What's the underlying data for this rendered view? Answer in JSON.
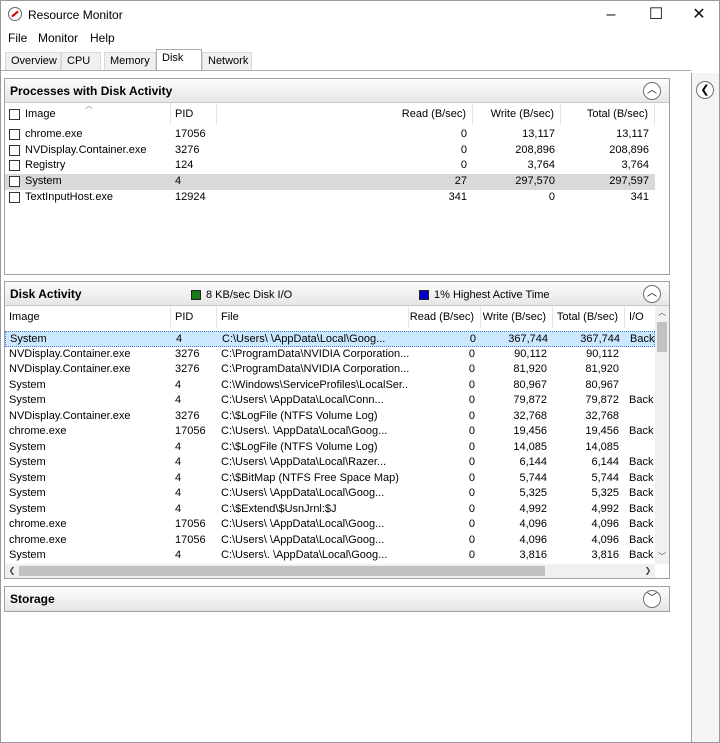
{
  "window": {
    "title": "Resource Monitor",
    "minimize": "–",
    "maximize": "☐",
    "close": "✕"
  },
  "menu": [
    "File",
    "Monitor",
    "Help"
  ],
  "tabs": [
    "Overview",
    "CPU",
    "Memory",
    "Disk",
    "Network"
  ],
  "active_tab": "Disk",
  "processes_panel": {
    "title": "Processes with Disk Activity",
    "columns": [
      "Image",
      "PID",
      "Read (B/sec)",
      "Write (B/sec)",
      "Total (B/sec)"
    ],
    "rows": [
      [
        "chrome.exe",
        "17056",
        "0",
        "13,117",
        "13,117"
      ],
      [
        "NVDisplay.Container.exe",
        "3276",
        "0",
        "208,896",
        "208,896"
      ],
      [
        "Registry",
        "124",
        "0",
        "3,764",
        "3,764"
      ],
      [
        "System",
        "4",
        "27",
        "297,570",
        "297,597"
      ],
      [
        "TextInputHost.exe",
        "12924",
        "341",
        "0",
        "341"
      ]
    ]
  },
  "disk_activity_panel": {
    "title": "Disk Activity",
    "legend": [
      {
        "label": "8 KB/sec Disk I/O",
        "color": "#1a7a1a"
      },
      {
        "label": "1% Highest Active Time",
        "color": "#0000cc"
      }
    ],
    "columns": [
      "Image",
      "PID",
      "File",
      "Read (B/sec)",
      "Write (B/sec)",
      "Total (B/sec)",
      "I/O"
    ],
    "rows": [
      [
        "System",
        "4",
        "C:\\Users\\        \\AppData\\Local\\Goog...",
        "0",
        "367,744",
        "367,744",
        "Back"
      ],
      [
        "NVDisplay.Container.exe",
        "3276",
        "C:\\ProgramData\\NVIDIA Corporation...",
        "0",
        "90,112",
        "90,112",
        ""
      ],
      [
        "NVDisplay.Container.exe",
        "3276",
        "C:\\ProgramData\\NVIDIA Corporation...",
        "0",
        "81,920",
        "81,920",
        ""
      ],
      [
        "System",
        "4",
        "C:\\Windows\\ServiceProfiles\\LocalSer...",
        "0",
        "80,967",
        "80,967",
        ""
      ],
      [
        "System",
        "4",
        "C:\\Users\\        \\AppData\\Local\\Conn...",
        "0",
        "79,872",
        "79,872",
        "Back"
      ],
      [
        "NVDisplay.Container.exe",
        "3276",
        "C:\\$LogFile (NTFS Volume Log)",
        "0",
        "32,768",
        "32,768",
        ""
      ],
      [
        "chrome.exe",
        "17056",
        "C:\\Users\\.       \\AppData\\Local\\Goog...",
        "0",
        "19,456",
        "19,456",
        "Back"
      ],
      [
        "System",
        "4",
        "C:\\$LogFile (NTFS Volume Log)",
        "0",
        "14,085",
        "14,085",
        ""
      ],
      [
        "System",
        "4",
        "C:\\Users\\        \\AppData\\Local\\Razer...",
        "0",
        "6,144",
        "6,144",
        "Back"
      ],
      [
        "System",
        "4",
        "C:\\$BitMap (NTFS Free Space Map)",
        "0",
        "5,744",
        "5,744",
        "Back"
      ],
      [
        "System",
        "4",
        "C:\\Users\\        \\AppData\\Local\\Goog...",
        "0",
        "5,325",
        "5,325",
        "Back"
      ],
      [
        "System",
        "4",
        "C:\\$Extend\\$UsnJrnl:$J",
        "0",
        "4,992",
        "4,992",
        "Back"
      ],
      [
        "chrome.exe",
        "17056",
        "C:\\Users\\        \\AppData\\Local\\Goog...",
        "0",
        "4,096",
        "4,096",
        "Back"
      ],
      [
        "chrome.exe",
        "17056",
        "C:\\Users\\        \\AppData\\Local\\Goog...",
        "0",
        "4,096",
        "4,096",
        "Back"
      ],
      [
        "System",
        "4",
        "C:\\Users\\.       \\AppData\\Local\\Goog...",
        "0",
        "3,816",
        "3,816",
        "Back"
      ]
    ]
  },
  "storage_panel": {
    "title": "Storage"
  }
}
